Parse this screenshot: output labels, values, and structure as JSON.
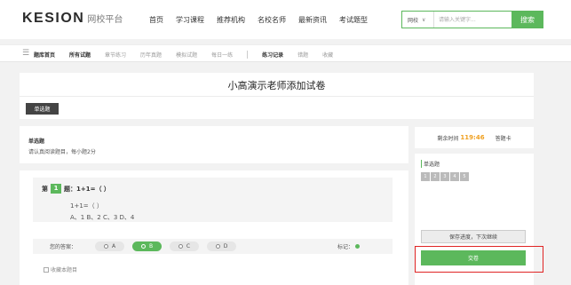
{
  "header": {
    "logo_main": "KESION",
    "logo_sub": "网校平台",
    "nav": [
      "首页",
      "学习课程",
      "推荐机构",
      "名校名师",
      "最新资讯",
      "考试题型"
    ],
    "search": {
      "select_value": "网校",
      "placeholder": "请输入关键字...",
      "button": "搜索"
    }
  },
  "subnav": {
    "items_left": [
      "题库首页",
      "所有试题",
      "章节练习",
      "历年真题",
      "模拟试题",
      "每日一练"
    ],
    "items_right": [
      "练习记录",
      "错题",
      "收藏"
    ]
  },
  "exam": {
    "title": "小高演示老师添加试卷",
    "type_tab": "单选题"
  },
  "question_section": {
    "type": "单选题",
    "desc": "请认真阅读题目，每小题2分"
  },
  "question": {
    "prefix": "第",
    "number": "1",
    "suffix": "题：1+1=（ ）",
    "stem": "1+1=（ ）",
    "options_line": "A、1  B、2  C、3  D、4",
    "answer_label": "您的答案：",
    "options": [
      "A",
      "B",
      "C",
      "D"
    ],
    "selected": "B",
    "mark_label": "标记：",
    "collect_label": "收藏本题目"
  },
  "sidebar": {
    "timer_label": "剩余时间",
    "timer_value": "119:46",
    "answer_card": "答题卡",
    "section_title": "单选题",
    "numbers": [
      "1",
      "2",
      "3",
      "4",
      "5"
    ],
    "save_button": "保存进度，下次继续",
    "submit_button": "交卷"
  },
  "colors": {
    "accent": "#5cb85c",
    "timer": "#f0a020",
    "highlight_border": "#e02424"
  }
}
